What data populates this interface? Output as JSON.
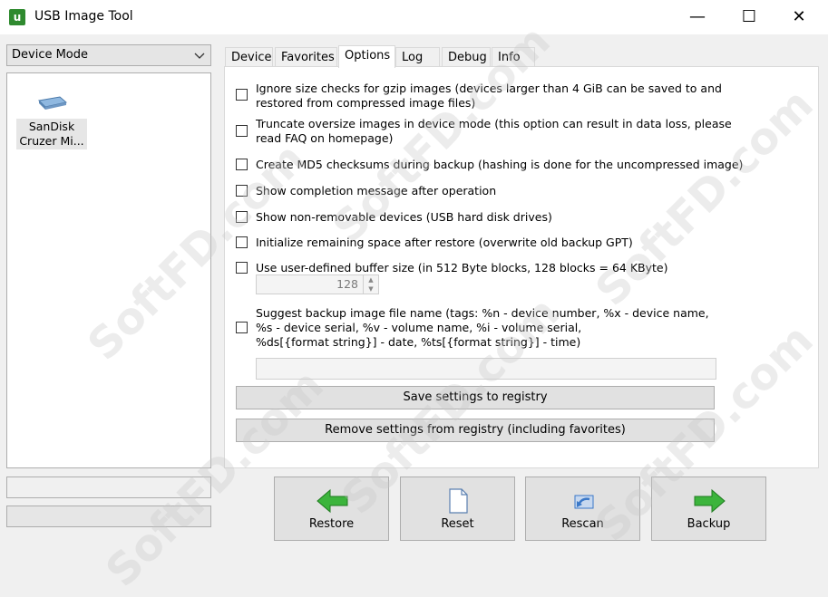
{
  "window": {
    "title": "USB Image Tool",
    "app_icon_glyph": "u",
    "controls": {
      "minimize": "—",
      "maximize": "☐",
      "close": "✕"
    }
  },
  "left": {
    "mode_select": {
      "value": "Device Mode"
    },
    "devices": [
      {
        "name_line1": "SanDisk",
        "name_line2": "Cruzer Mi..."
      }
    ]
  },
  "tabs": [
    {
      "label": "Device",
      "active": false
    },
    {
      "label": "Favorites",
      "active": false
    },
    {
      "label": "Options",
      "active": true
    },
    {
      "label": "Log",
      "active": false
    },
    {
      "label": "Debug",
      "active": false
    },
    {
      "label": "Info",
      "active": false
    }
  ],
  "options": [
    {
      "line1": "Ignore size checks for gzip images (devices larger than 4 GiB can be saved to and",
      "line2": "restored from compressed image files)",
      "checked": false
    },
    {
      "line1": "Truncate oversize images in device mode (this option can result in data loss, please",
      "line2": "read FAQ on homepage)",
      "checked": false
    },
    {
      "line1": "Create MD5 checksums during backup (hashing is done for the uncompressed image)",
      "checked": false
    },
    {
      "line1": "Show completion message after operation",
      "checked": false
    },
    {
      "line1": "Show non-removable devices (USB hard disk drives)",
      "checked": false
    },
    {
      "line1": "Initialize remaining space after restore (overwrite old backup GPT)",
      "checked": false
    },
    {
      "line1": "Use user-defined buffer size (in 512 Byte blocks, 128 blocks = 64 KByte)",
      "checked": false
    },
    {
      "line1": "Suggest backup image file name (tags: %n - device number, %x - device name,",
      "line2": "%s - device serial, %v - volume name, %i - volume serial,",
      "line3": "%ds[{format string}] - date, %ts[{format string}] - time)",
      "checked": false
    }
  ],
  "buffer_size": {
    "value": "128"
  },
  "filename_pattern": {
    "value": ""
  },
  "buttons": {
    "save_settings": "Save settings to registry",
    "remove_settings": "Remove settings from registry (including favorites)",
    "restore": "Restore",
    "reset": "Reset",
    "rescan": "Rescan",
    "backup": "Backup"
  },
  "watermark": "SoftFD.com",
  "colors": {
    "arrow_green": "#3cb43c",
    "rescan_blue": "#3a78c8",
    "checkbox_border": "#333333"
  }
}
